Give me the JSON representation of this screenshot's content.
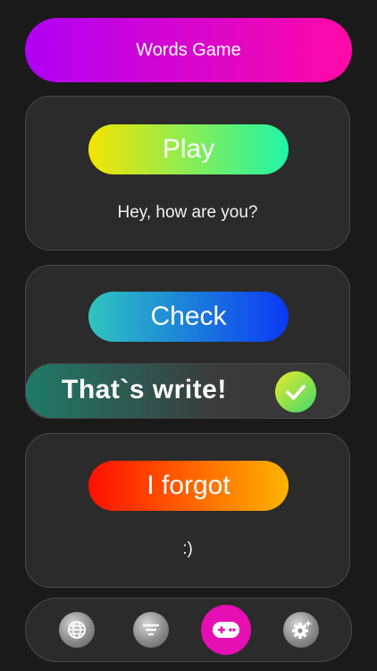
{
  "header": {
    "title": "Words Game",
    "gradient": [
      "#b000f5",
      "#ff0aa6"
    ]
  },
  "cards": {
    "play": {
      "button_label": "Play",
      "text": "Hey, how are you?",
      "gradient": [
        "#f5e400",
        "#1ff5a8"
      ]
    },
    "check": {
      "button_label": "Check",
      "gradient": [
        "#2ec6bf",
        "#0b39f5"
      ]
    },
    "forgot": {
      "button_label": "I forgot",
      "text": ":)",
      "gradient": [
        "#ff1000",
        "#ffb400"
      ]
    }
  },
  "toast": {
    "message": "That`s write!",
    "icon": "checkmark-icon"
  },
  "tab_bar": {
    "items": [
      {
        "name": "globe",
        "icon": "globe-icon",
        "active": false
      },
      {
        "name": "filter",
        "icon": "filter-icon",
        "active": false
      },
      {
        "name": "game",
        "icon": "gamepad-icon",
        "active": true,
        "color": "#e60fb4"
      },
      {
        "name": "settings",
        "icon": "gear-icon",
        "active": false
      }
    ]
  },
  "colors": {
    "background": "#1a1a1a",
    "card": "#2b2b2b",
    "card_border": "#4a4a4a"
  }
}
